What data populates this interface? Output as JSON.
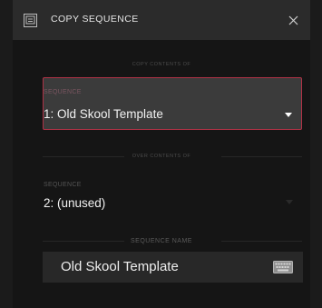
{
  "dialog": {
    "title": "COPY SEQUENCE",
    "title_icon": "copy-sequence-icon",
    "close_icon": "close-icon"
  },
  "copy_from": {
    "section_label": "COPY CONTENTS OF",
    "caption": "SEQUENCE",
    "value": "1: Old Skool Template",
    "dropdown_icon": "dropdown-arrow-icon"
  },
  "copy_to": {
    "section_label": "OVER CONTENTS OF",
    "caption": "SEQUENCE",
    "value": "2: (unused)",
    "dropdown_icon": "dropdown-arrow-icon"
  },
  "sequence_name": {
    "section_label": "SEQUENCE NAME",
    "value": "Old Skool Template",
    "keyboard_icon": "keyboard-icon"
  },
  "colors": {
    "background": "#1b1b1b",
    "titlebar": "#2b2b2b",
    "selected_field": "#3b3b3b",
    "accent_border": "#b03246",
    "name_box": "#282828"
  }
}
